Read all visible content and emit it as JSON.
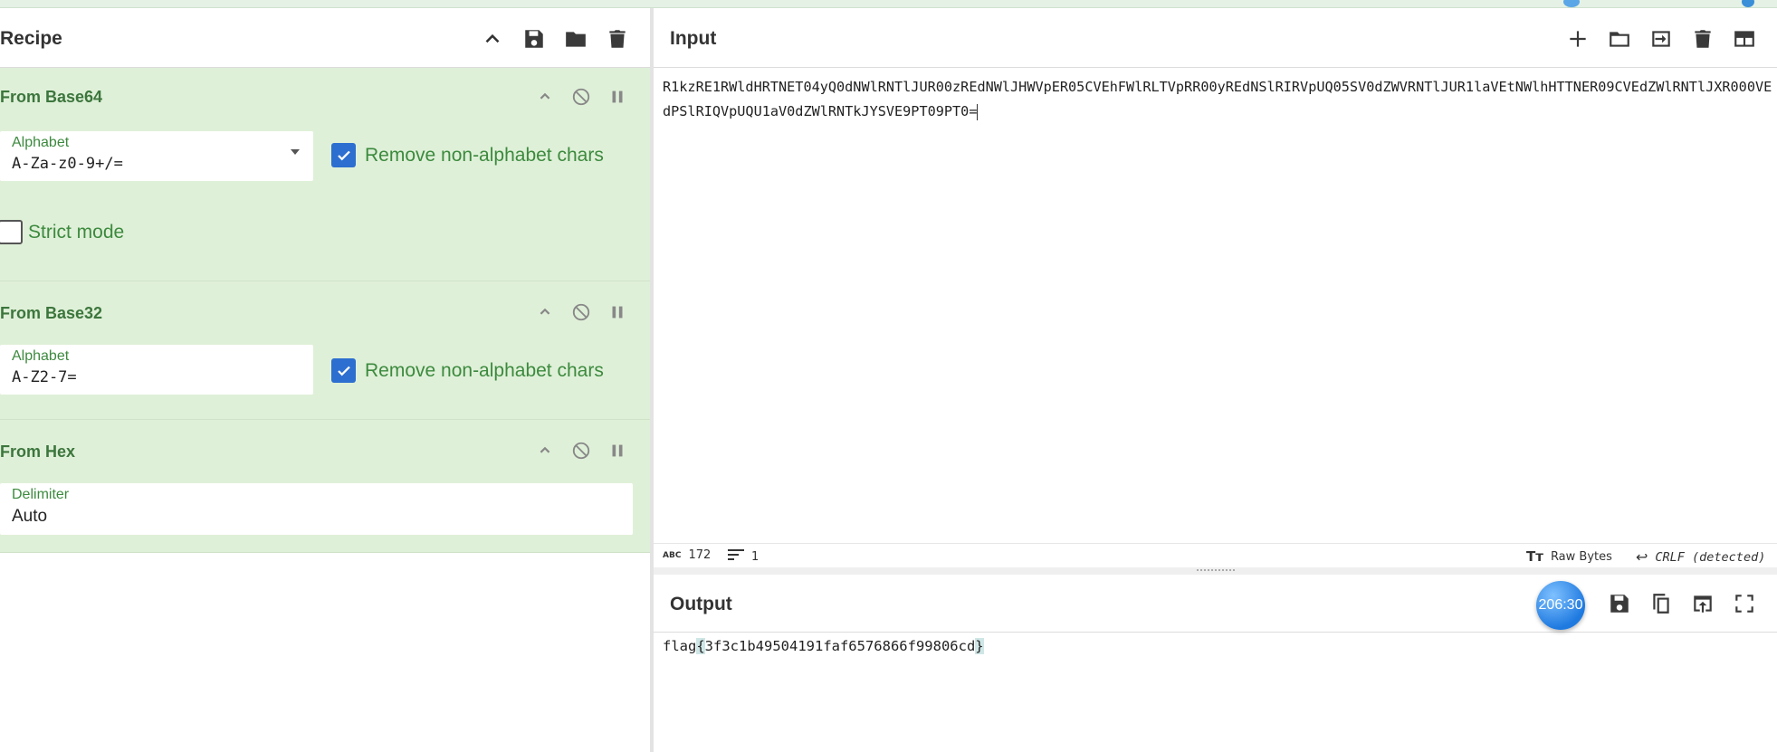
{
  "recipe": {
    "title": "Recipe",
    "operations": [
      {
        "name": "From Base64",
        "alphabet_label": "Alphabet",
        "alphabet_value": "A-Za-z0-9+/=",
        "remove_label": "Remove non-alphabet chars",
        "remove_checked": true,
        "strict_label": "Strict mode",
        "strict_checked": false
      },
      {
        "name": "From Base32",
        "alphabet_label": "Alphabet",
        "alphabet_value": "A-Z2-7=",
        "remove_label": "Remove non-alphabet chars",
        "remove_checked": true
      },
      {
        "name": "From Hex",
        "delimiter_label": "Delimiter",
        "delimiter_value": "Auto"
      }
    ]
  },
  "input": {
    "title": "Input",
    "text": "R1kzRE1RWldHRTNET04yQ0dNWlRNTlJUR00zREdNWlJHWVpER05CVEhFWlRLTVpRR00yREdNSlRIRVpUQ05SV0dZWVRNTlJUR1laVEtNWlhHTTNER09CVEdZWlRNTlJXR000VEdPSlRIQVpUQU1aV0dZWlRNTkJYSVE9PT09PT0=",
    "char_count": "172",
    "line_count": "1",
    "encoding": "Raw Bytes",
    "eol": "CRLF (detected)"
  },
  "output": {
    "title": "Output",
    "timer": "206:30",
    "prefix": "flag",
    "open_brace": "{",
    "content": "3f3c1b49504191faf6576866f99806cd",
    "close_brace": "}"
  },
  "colors": {
    "op_bg": "#dff0d8",
    "op_title": "#3c763d",
    "checkbox": "#2d6fd0",
    "accent_blue": "#1f7ae0"
  },
  "icons": [
    "chevron-up-icon",
    "save-icon",
    "folder-icon",
    "trash-icon",
    "disable-icon",
    "pause-icon",
    "plus-icon",
    "import-icon",
    "layout-icon",
    "copy-icon",
    "replace-input-icon",
    "maximize-icon"
  ]
}
